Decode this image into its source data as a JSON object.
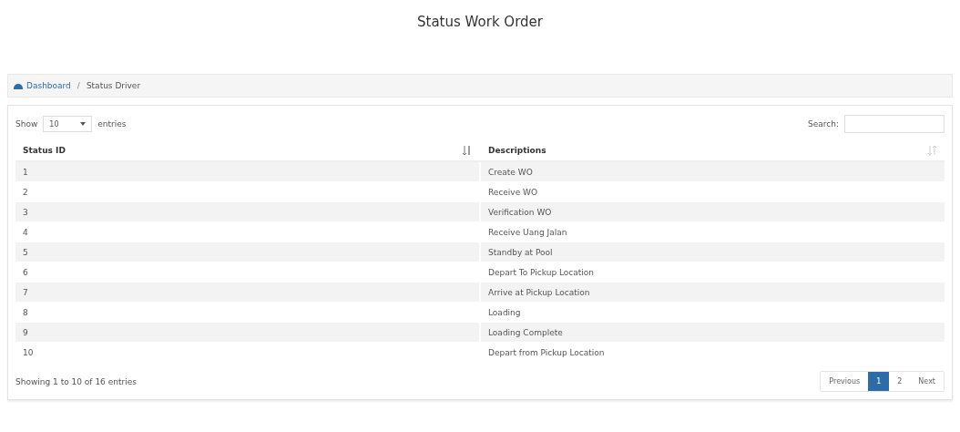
{
  "page_title": "Status Work Order",
  "breadcrumb": [
    {
      "label": "Dashboard",
      "kind": "home"
    },
    {
      "label": "/",
      "kind": "separator"
    },
    {
      "label": "Status Driver",
      "kind": "current"
    }
  ],
  "length_menu": {
    "before": "Show",
    "value": "10",
    "after": "entries"
  },
  "search": {
    "label": "Search:"
  },
  "table": {
    "columns": [
      {
        "label": "Status ID",
        "sorted": true
      },
      {
        "label": "Descriptions",
        "sorted": false
      }
    ],
    "rows": [
      [
        "1",
        "Create WO"
      ],
      [
        "2",
        "Receive WO"
      ],
      [
        "3",
        "Verification WO"
      ],
      [
        "4",
        "Receive Uang Jalan"
      ],
      [
        "5",
        "Standby at Pool"
      ],
      [
        "6",
        "Depart To Pickup Location"
      ],
      [
        "7",
        "Arrive at Pickup Location"
      ],
      [
        "8",
        "Loading"
      ],
      [
        "9",
        "Loading Complete"
      ],
      [
        "10",
        "Depart from Pickup Location"
      ]
    ]
  },
  "info": "Showing 1 to 10 of 16 entries",
  "pagination": [
    {
      "label": "Previous",
      "selected": false
    },
    {
      "label": "1",
      "selected": true
    },
    {
      "label": "2",
      "selected": false
    },
    {
      "label": "Next",
      "selected": false
    }
  ]
}
